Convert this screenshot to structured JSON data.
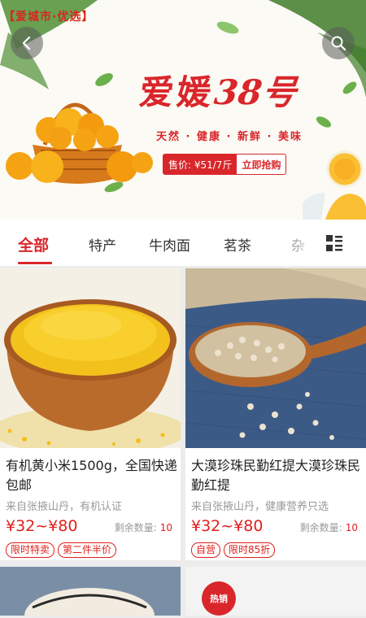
{
  "banner": {
    "brand_tag": "【爱城市·优选】",
    "headline": "爱媛",
    "headline_num": "38号",
    "tagline": "天然 · 健康 · 新鲜 · 美味",
    "price": "售价: ¥51/7斤",
    "buy_label": "立即抢购",
    "back_icon": "chevron-left-icon",
    "search_icon": "search-icon"
  },
  "tabs": {
    "items": [
      "全部",
      "特产",
      "牛肉面",
      "茗茶",
      "杂"
    ],
    "active_index": 0,
    "grid_icon": "category-grid-icon"
  },
  "products": [
    {
      "title": "有机黄小米1500g，全国快递包邮",
      "subtitle": "来自张掖山丹，有机认证",
      "price": "¥32~¥80",
      "stock_label": "剩余数量:",
      "stock_value": "10",
      "badges": [
        "限时特卖",
        "第二件半价"
      ],
      "image": "millet-bowl"
    },
    {
      "title": "大漠珍珠民勤红提大漠珍珠民勤红提",
      "subtitle": "来自张掖山丹，健康营养只选",
      "price": "¥32~¥80",
      "stock_label": "剩余数量:",
      "stock_value": "10",
      "badges": [
        "自营",
        "限时85折"
      ],
      "image": "quinoa-spoon"
    }
  ],
  "peek": {
    "hot_label": "热销"
  },
  "colors": {
    "accent": "#d9262b",
    "price": "#e0201c",
    "muted": "#999999"
  }
}
